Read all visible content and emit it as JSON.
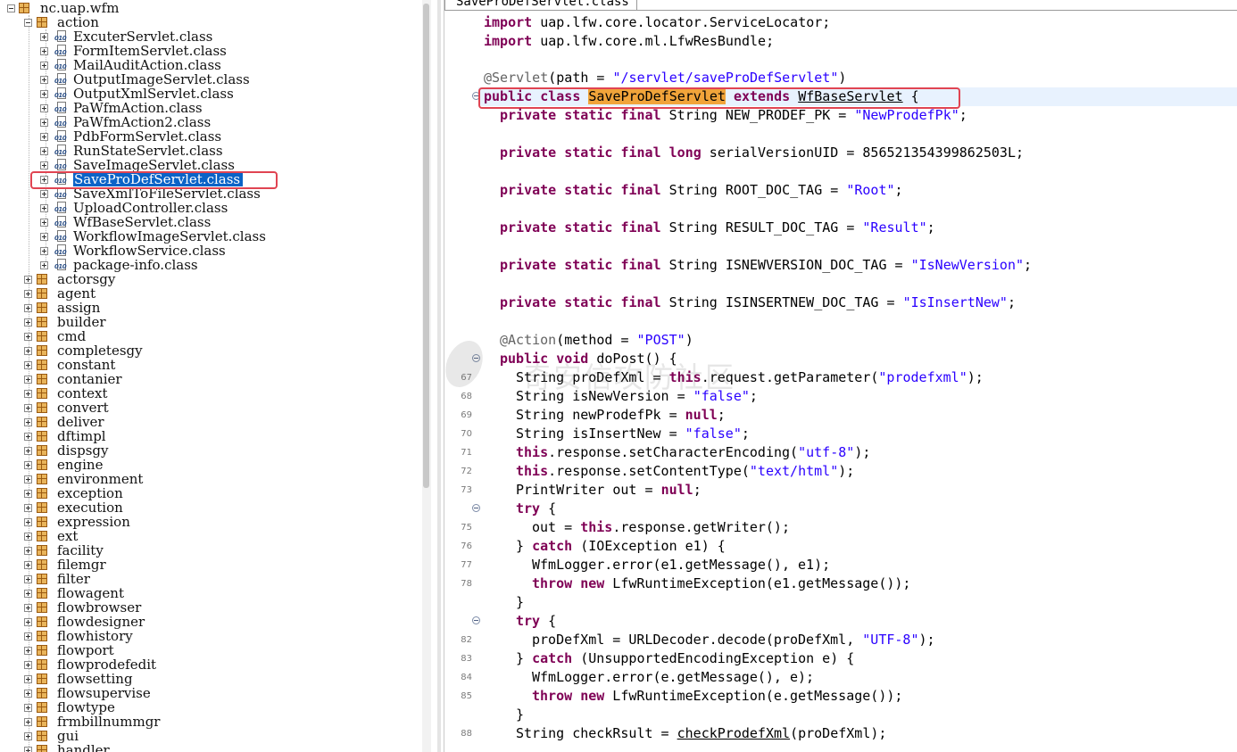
{
  "tree": {
    "root_label": "nc.uap.wfm",
    "action_label": "action",
    "class_files": [
      "ExcuterServlet.class",
      "FormItemServlet.class",
      "MailAuditAction.class",
      "OutputImageServlet.class",
      "OutputXmlServlet.class",
      "PaWfmAction.class",
      "PaWfmAction2.class",
      "PdbFormServlet.class",
      "RunStateServlet.class",
      "SaveImageServlet.class",
      "SaveProDefServlet.class",
      "SaveXmlToFileServlet.class",
      "UploadController.class",
      "WfBaseServlet.class",
      "WorkflowImageServlet.class",
      "WorkflowService.class",
      "package-info.class"
    ],
    "selected_file": "SaveProDefServlet.class",
    "packages": [
      "actorsgy",
      "agent",
      "assign",
      "builder",
      "cmd",
      "completesgy",
      "constant",
      "contanier",
      "context",
      "convert",
      "deliver",
      "dftimpl",
      "dispsgy",
      "engine",
      "environment",
      "exception",
      "execution",
      "expression",
      "ext",
      "facility",
      "filemgr",
      "filter",
      "flowagent",
      "flowbrowser",
      "flowdesigner",
      "flowhistory",
      "flowport",
      "flowprodefedit",
      "flowsetting",
      "flowsupervise",
      "flowtype",
      "frmbillnummgr",
      "gui",
      "handler"
    ]
  },
  "editor": {
    "tab_title": "SaveProDefServlet.class",
    "line_numbers": {
      "l67": "67",
      "l68": "68",
      "l69": "69",
      "l70": "70",
      "l71": "71",
      "l72": "72",
      "l73": "73",
      "l75": "75",
      "l76": "76",
      "l77": "77",
      "l78": "78",
      "l82": "82",
      "l83": "83",
      "l84": "84",
      "l85": "85",
      "l88": "88"
    },
    "t": {
      "import": "import",
      "import1": " uap.lfw.core.locator.ServiceLocator;",
      "import2": " uap.lfw.core.ml.LfwResBundle;",
      "servlet_ann": "@Servlet",
      "path_open": "(path = ",
      "path_val": "\"/servlet/saveProDefServlet\"",
      "close_paren": ")",
      "public": "public",
      "class": "class",
      "class_name": "SaveProDefServlet",
      "extends": "extends",
      "base_class": "WfBaseServlet",
      "brace_open": " {",
      "private": "private",
      "static": "static",
      "final": "final",
      "long": "long",
      "string_type": " String ",
      "f1_name": "NEW_PRODEF_PK = ",
      "f1_val": "\"NewProdefPk\"",
      "semi": ";",
      "f2_rest": " serialVersionUID = 856521354399862503L;",
      "f3_name": "ROOT_DOC_TAG = ",
      "f3_val": "\"Root\"",
      "f4_name": "RESULT_DOC_TAG = ",
      "f4_val": "\"Result\"",
      "f5_name": "ISNEWVERSION_DOC_TAG = ",
      "f5_val": "\"IsNewVersion\"",
      "f6_name": "ISINSERTNEW_DOC_TAG = ",
      "f6_val": "\"IsInsertNew\"",
      "action_ann": "@Action",
      "method_open": "(method = ",
      "method_val": "\"POST\"",
      "void": "void",
      "dopost": " doPost() {",
      "l67a": "String proDefXml = ",
      "this": "this",
      "l67b": ".request.getParameter(",
      "l67s": "\"prodefxml\"",
      "close_semi": ");",
      "l68a": "String isNewVersion = ",
      "false_str": "\"false\"",
      "l69a": "String newProdefPk = ",
      "null": "null",
      "l70a": "String isInsertNew = ",
      "l71a": ".response.setCharacterEncoding(",
      "l71s": "\"utf-8\"",
      "l72a": ".response.setContentType(",
      "l72s": "\"text/html\"",
      "l73a": "PrintWriter out = ",
      "try": "try",
      "try_brace": " {",
      "l75a": "out = ",
      "l75b": ".response.getWriter();",
      "close_brace": "} ",
      "catch": "catch",
      "l76b": " (IOException e1) {",
      "l77": "WfmLogger.error(e1.getMessage(), e1);",
      "throw": "throw",
      "new": "new",
      "l78b": " LfwRuntimeException(e1.getMessage());",
      "brace_close": "}",
      "l82a": "proDefXml = URLDecoder.decode(proDefXml, ",
      "l82s": "\"UTF-8\"",
      "l83b": " (UnsupportedEncodingException e) {",
      "l84": "WfmLogger.error(e.getMessage(), e);",
      "l85b": " LfwRuntimeException(e.getMessage());",
      "l88a": "String checkRsult = ",
      "l88u": "checkProdefXml",
      "l88b": "(proDefXml);",
      "sp": " "
    }
  },
  "watermark": {
    "text": "奇安信攻防社区"
  },
  "colors": {
    "keyword": "#7f0055",
    "string": "#2a00ff",
    "annotation": "#646464",
    "selection": "#0a63c7",
    "highlight_box": "#e04452",
    "class_highlight": "#f1a43a"
  }
}
